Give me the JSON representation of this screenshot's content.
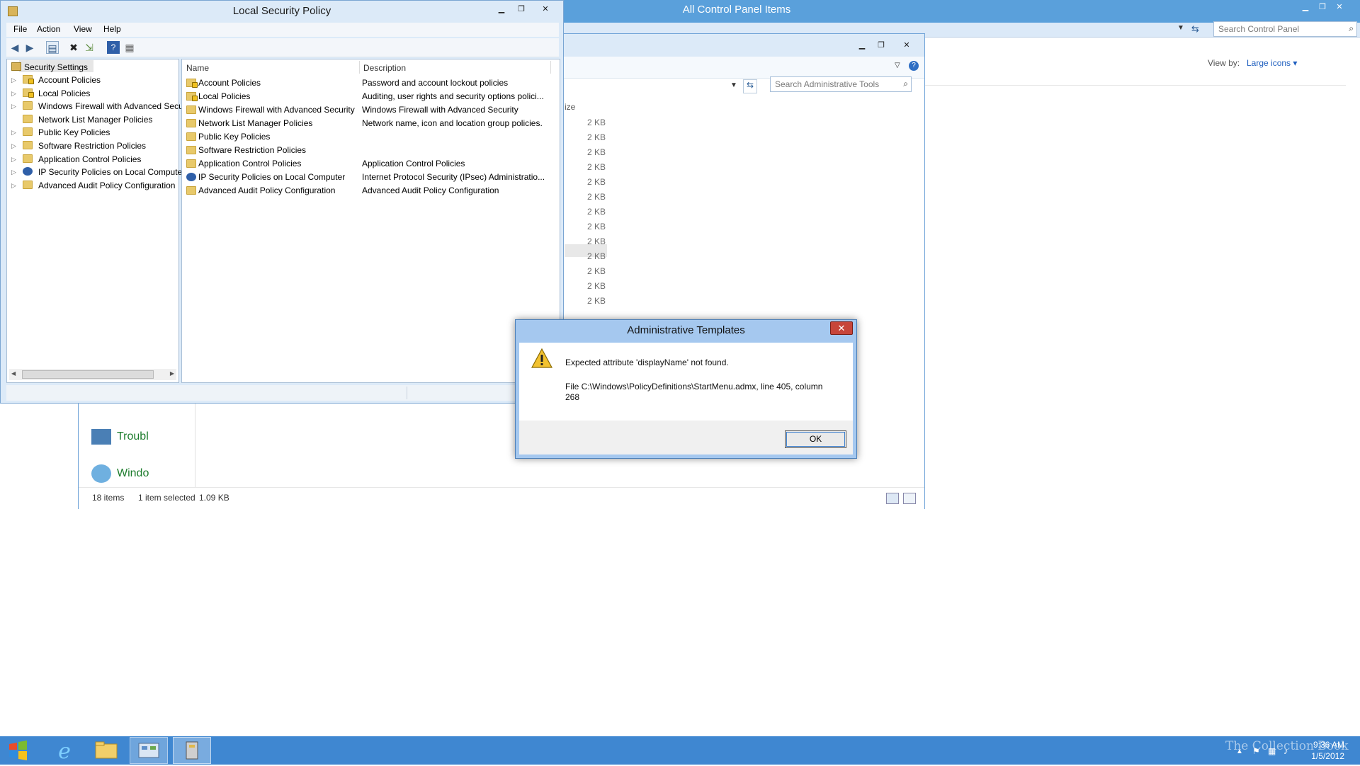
{
  "control_panel": {
    "title": "All Control Panel Items",
    "search_placeholder": "Search Control Panel",
    "view_by_label": "View by:",
    "view_by_value": "Large icons ▾",
    "items": [
      {
        "label": "Troubl"
      },
      {
        "label": "Windo"
      }
    ]
  },
  "admin_tools": {
    "search_placeholder": "Search Administrative Tools",
    "size_header": "ize",
    "sizes": [
      "2 KB",
      "2 KB",
      "2 KB",
      "2 KB",
      "2 KB",
      "2 KB",
      "2 KB",
      "2 KB",
      "2 KB",
      "2 KB",
      "2 KB",
      "2 KB",
      "2 KB"
    ],
    "status": {
      "count": "18 items",
      "selected": "1 item selected",
      "size": "1.09 KB"
    }
  },
  "lsp": {
    "title": "Local Security Policy",
    "menu": [
      "File",
      "Action",
      "View",
      "Help"
    ],
    "tree_root": "Security Settings",
    "tree": [
      {
        "label": "Account Policies",
        "icon": "folder-lock"
      },
      {
        "label": "Local Policies",
        "icon": "folder-lock"
      },
      {
        "label": "Windows Firewall with Advanced Secu",
        "icon": "folder"
      },
      {
        "label": "Network List Manager Policies",
        "icon": "folder"
      },
      {
        "label": "Public Key Policies",
        "icon": "folder"
      },
      {
        "label": "Software Restriction Policies",
        "icon": "folder"
      },
      {
        "label": "Application Control Policies",
        "icon": "folder"
      },
      {
        "label": "IP Security Policies on Local Compute",
        "icon": "shield"
      },
      {
        "label": "Advanced Audit Policy Configuration",
        "icon": "folder"
      }
    ],
    "columns": {
      "name": "Name",
      "description": "Description"
    },
    "rows": [
      {
        "name": "Account Policies",
        "description": "Password and account lockout policies",
        "icon": "folder-lock"
      },
      {
        "name": "Local Policies",
        "description": "Auditing, user rights and security options polici...",
        "icon": "folder-lock"
      },
      {
        "name": "Windows Firewall with Advanced Security",
        "description": "Windows Firewall with Advanced Security",
        "icon": "folder"
      },
      {
        "name": "Network List Manager Policies",
        "description": "Network name, icon and location group policies.",
        "icon": "folder"
      },
      {
        "name": "Public Key Policies",
        "description": "",
        "icon": "folder"
      },
      {
        "name": "Software Restriction Policies",
        "description": "",
        "icon": "folder"
      },
      {
        "name": "Application Control Policies",
        "description": "Application Control Policies",
        "icon": "folder"
      },
      {
        "name": "IP Security Policies on Local Computer",
        "description": "Internet Protocol Security (IPsec) Administratio...",
        "icon": "shield"
      },
      {
        "name": "Advanced Audit Policy Configuration",
        "description": "Advanced Audit Policy Configuration",
        "icon": "folder"
      }
    ]
  },
  "dialog": {
    "title": "Administrative Templates",
    "close_label": "✕",
    "message": "Expected attribute 'displayName' not found.",
    "detail": "File C:\\Windows\\PolicyDefinitions\\StartMenu.admx, line 405, column 268",
    "ok_label": "OK"
  },
  "taskbar": {
    "time": "9:36 AM",
    "date": "1/5/2012",
    "watermark": "The Collection Book"
  },
  "colors": {
    "taskbar": "#3f87d1",
    "title_active": "#5aa0db",
    "dialog_frame": "#a5c8ef",
    "close_red": "#c7453a"
  }
}
